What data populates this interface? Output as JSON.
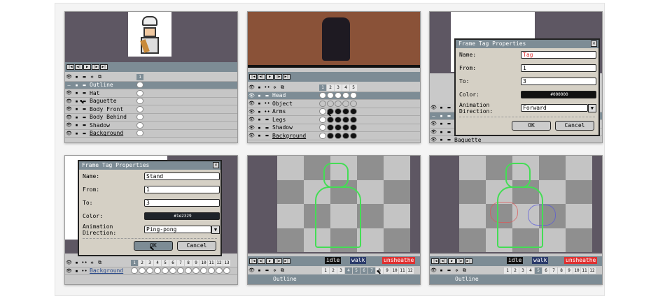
{
  "panel1": {
    "layers": [
      "Outline",
      "Hat",
      "Baguette",
      "Body Front",
      "Body Behind",
      "Shadow",
      "Background"
    ],
    "selected_layer": "Outline",
    "frames": [
      "1"
    ]
  },
  "panel2": {
    "layers": [
      "Head",
      "Object",
      "Arms",
      "Legs",
      "Shadow",
      "Background"
    ],
    "selected_layer": "Head",
    "frames": [
      "1",
      "2",
      "3",
      "4",
      "5"
    ]
  },
  "panel3": {
    "dialog": {
      "title": "Frame Tag Properties",
      "name_label": "Name:",
      "name_value": "Tag",
      "from_label": "From:",
      "from_value": "1",
      "to_label": "To:",
      "to_value": "3",
      "color_label": "Color:",
      "color_value": "#000000",
      "direction_label": "Animation Direction:",
      "direction_value": "Forward",
      "ok": "OK",
      "cancel": "Cancel"
    },
    "visible_layer": "Baguette"
  },
  "panel4": {
    "dialog": {
      "title": "Frame Tag Properties",
      "name_label": "Name:",
      "name_value": "Stand",
      "from_label": "From:",
      "from_value": "1",
      "to_label": "To:",
      "to_value": "3",
      "color_label": "Color:",
      "color_value": "#1e2329",
      "direction_label": "Animation Direction:",
      "direction_value": "Ping-pong",
      "ok": "OK",
      "cancel": "Cancel"
    },
    "layer": "Background",
    "frames": [
      "1",
      "2",
      "3",
      "4",
      "5",
      "6",
      "7",
      "8",
      "9",
      "10",
      "11",
      "12",
      "13"
    ]
  },
  "panel5": {
    "tags": [
      {
        "name": "idle",
        "color": "#111111"
      },
      {
        "name": "walk",
        "color": "#2a3a6a"
      },
      {
        "name": "unsheathe",
        "color": "#e03030"
      }
    ],
    "frames": [
      "1",
      "2",
      "3",
      "4",
      "5",
      "6",
      "7",
      "8",
      "9",
      "10",
      "11",
      "12"
    ],
    "layer": "Outline"
  },
  "panel6": {
    "tags": [
      {
        "name": "idle",
        "color": "#111111"
      },
      {
        "name": "walk",
        "color": "#2a3a6a"
      },
      {
        "name": "unsheathe",
        "color": "#e03030"
      }
    ],
    "frames": [
      "1",
      "2",
      "3",
      "4",
      "5",
      "6",
      "7",
      "8",
      "9",
      "10",
      "11",
      "12"
    ],
    "layer": "Outline"
  },
  "colors": {
    "accent": "#7d8c95",
    "onion_green": "#44dd55"
  }
}
